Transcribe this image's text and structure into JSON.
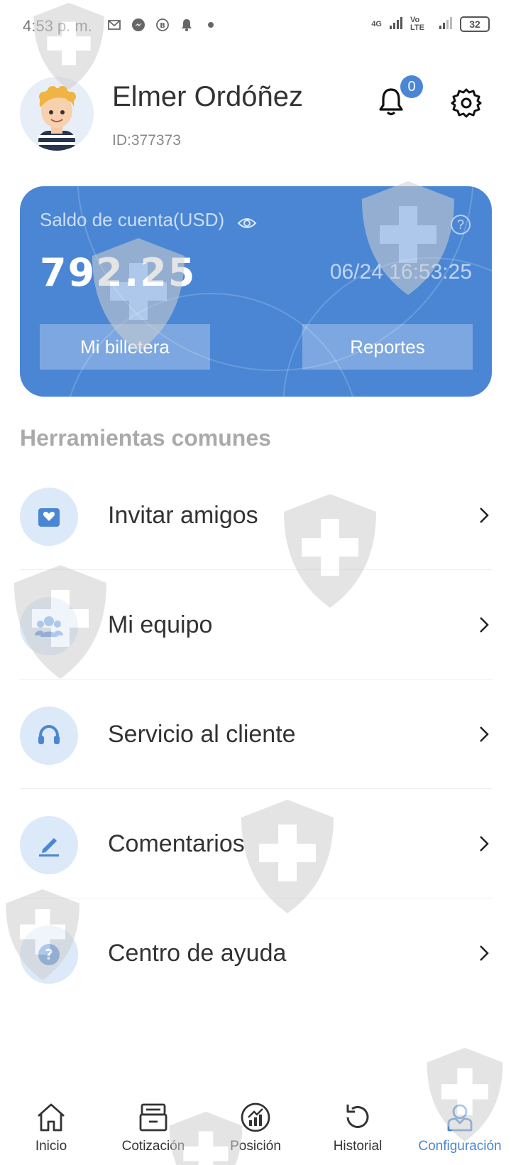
{
  "status_bar": {
    "time": "4:53 p. m.",
    "battery": "32",
    "network_1": "4G",
    "network_2": "Vo LTE"
  },
  "profile": {
    "name": "Elmer Ordóñez",
    "id": "ID:377373",
    "notification_count": "0"
  },
  "balance_card": {
    "label": "Saldo de cuenta(USD)",
    "value": "792.25",
    "timestamp": "06/24 16:53:25",
    "wallet_button": "Mi billetera",
    "reports_button": "Reportes",
    "help_glyph": "?"
  },
  "tools": {
    "title": "Herramientas comunes",
    "items": [
      {
        "label": "Invitar amigos",
        "icon": "invite-icon"
      },
      {
        "label": "Mi equipo",
        "icon": "team-icon"
      },
      {
        "label": "Servicio al cliente",
        "icon": "headset-icon"
      },
      {
        "label": "Comentarios",
        "icon": "pencil-icon"
      },
      {
        "label": "Centro de ayuda",
        "icon": "help-icon"
      }
    ]
  },
  "bottom_nav": {
    "items": [
      {
        "label": "Inicio",
        "icon": "home-icon"
      },
      {
        "label": "Cotización",
        "icon": "quote-icon"
      },
      {
        "label": "Posición",
        "icon": "position-icon"
      },
      {
        "label": "Historial",
        "icon": "history-icon"
      },
      {
        "label": "Configuración",
        "icon": "profile-icon"
      }
    ],
    "active": "Configuración"
  },
  "colors": {
    "accent": "#4a86d4",
    "card": "#4a86d4",
    "icon_bg": "#dce9f8"
  }
}
